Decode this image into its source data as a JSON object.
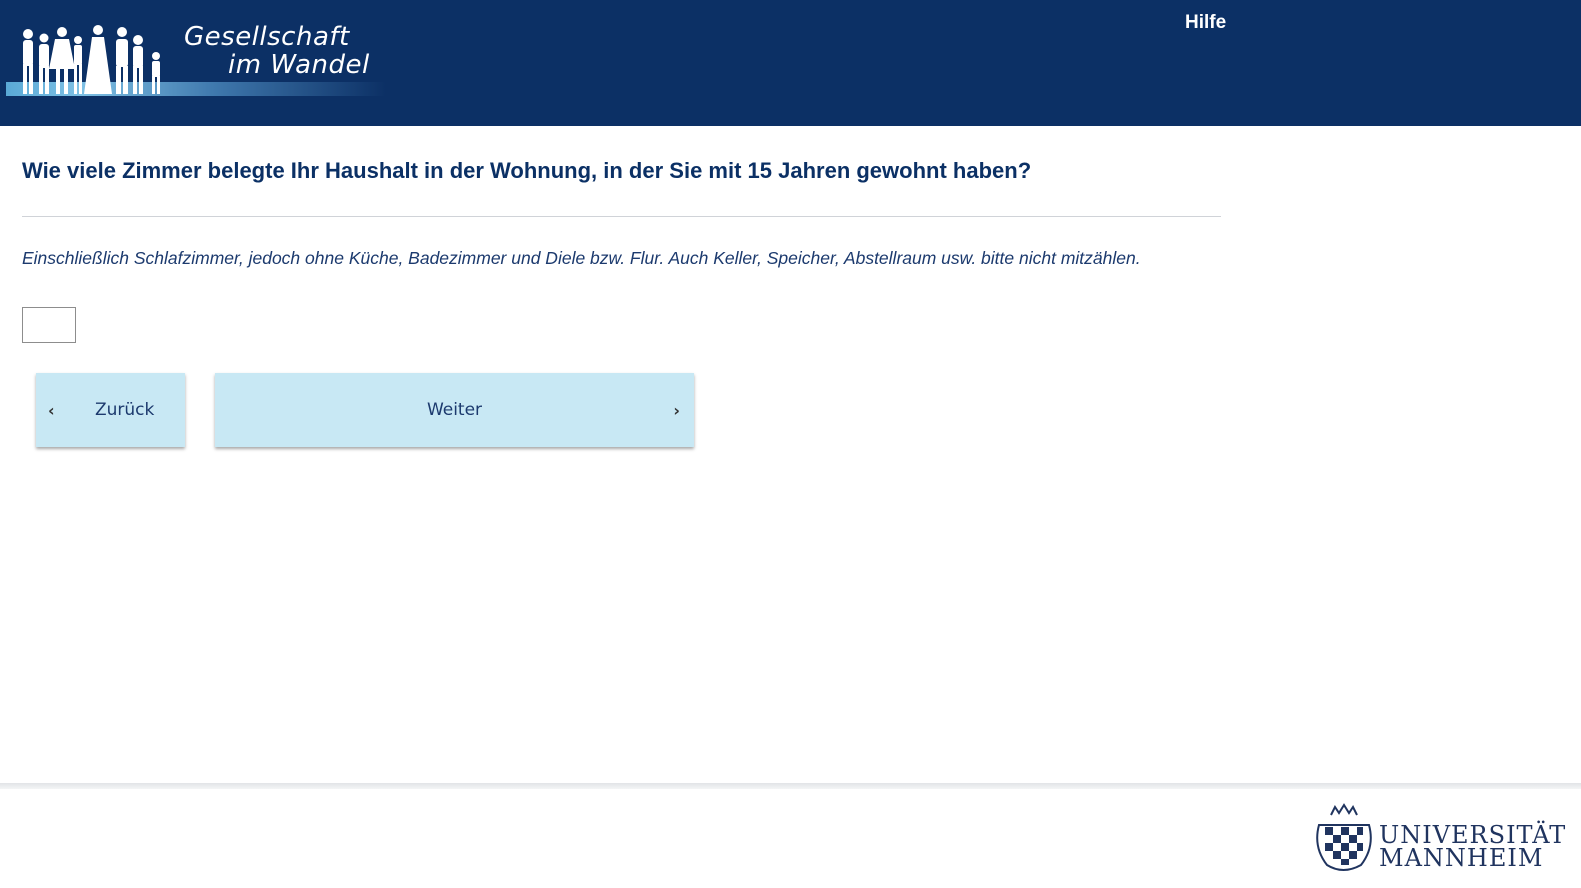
{
  "header": {
    "logo_line1": "Gesellschaft",
    "logo_line2": "im Wandel",
    "help_label": "Hilfe",
    "background_color": "#0c3065"
  },
  "main": {
    "question": "Wie viele Zimmer belegte Ihr Haushalt in der Wohnung, in der Sie mit 15 Jahren gewohnt haben?",
    "hint": "Einschließlich Schlafzimmer, jedoch ohne Küche, Badezimmer und Diele bzw. Flur. Auch Keller, Speicher, Abstellraum usw. bitte nicht mitzählen.",
    "answer_value": ""
  },
  "navigation": {
    "back_label": "Zurück",
    "next_label": "Weiter",
    "back_icon": "chevron-left-icon",
    "next_icon": "chevron-right-icon",
    "button_color": "#c8e8f4"
  },
  "footer": {
    "university_line1": "UNIVERSITÄT",
    "university_line2": "MANNHEIM"
  }
}
